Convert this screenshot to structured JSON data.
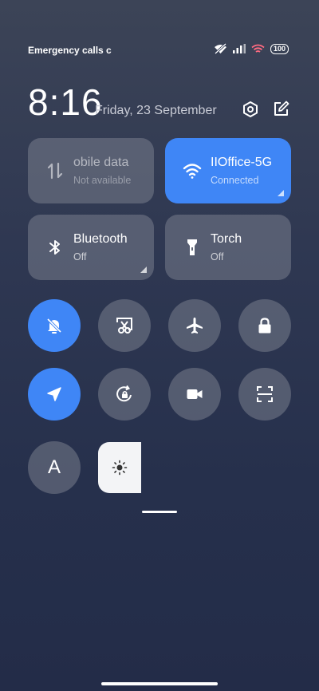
{
  "status_bar": {
    "carrier_text": "Emergency calls c",
    "battery": "100"
  },
  "header": {
    "time": "8:16",
    "date": "Friday, 23 September"
  },
  "tiles": {
    "mobile_data": {
      "title": "obile data",
      "subtitle": "Not available"
    },
    "wifi": {
      "title": "IIOffice-5G",
      "subtitle": "Connected"
    },
    "bluetooth": {
      "title": "Bluetooth",
      "subtitle": "Off"
    },
    "torch": {
      "title": "Torch",
      "subtitle": "Off"
    }
  },
  "toggles": {
    "font_letter": "A"
  },
  "colors": {
    "accent": "#3f86f6",
    "inactive": "#6a707e",
    "background": "#2b3450"
  },
  "icons": [
    "wifi-off-icon",
    "signal-icon",
    "wifi-icon",
    "battery-icon",
    "settings-icon",
    "edit-icon",
    "mobile-data-icon",
    "bluetooth-icon",
    "torch-icon",
    "silent-bell-icon",
    "screenshot-icon",
    "airplane-icon",
    "lock-icon",
    "location-icon",
    "rotation-lock-icon",
    "video-icon",
    "scan-icon",
    "brightness-icon"
  ]
}
